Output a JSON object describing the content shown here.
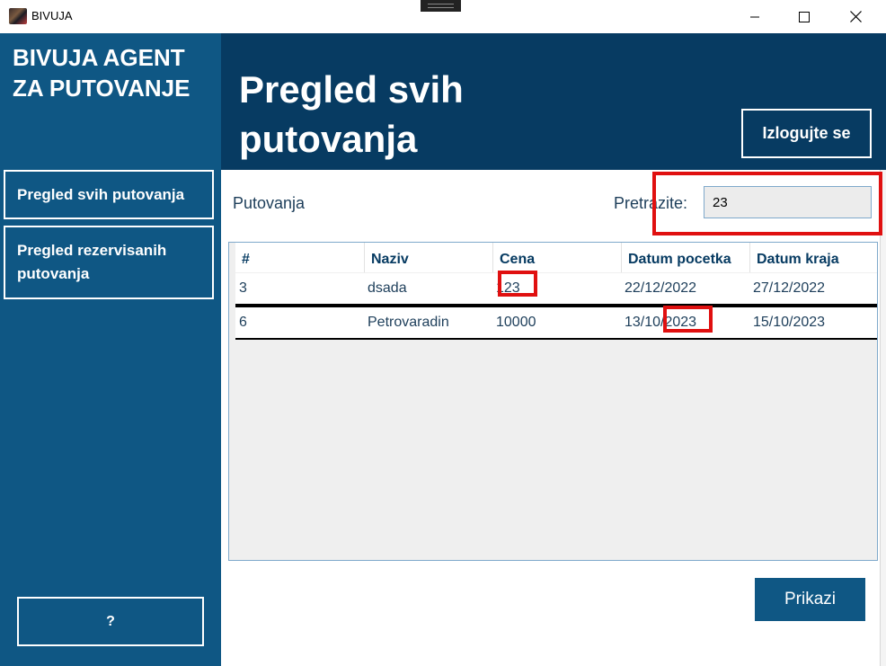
{
  "window": {
    "title": "BIVUJA"
  },
  "sidebar": {
    "brand": "BIVUJA AGENT ZA PUTOVANJE",
    "nav": [
      {
        "label": "Pregled svih putovanja"
      },
      {
        "label": "Pregled rezervisanih putovanja"
      }
    ],
    "help_label": "?"
  },
  "header": {
    "title": "Pregled svih putovanja",
    "logout_label": "Izlogujte se"
  },
  "content": {
    "section_label": "Putovanja",
    "search_label": "Pretrazite:",
    "search_value": "23"
  },
  "table": {
    "columns": [
      "#",
      "Naziv",
      "Cena",
      "Datum pocetka",
      "Datum kraja"
    ],
    "rows": [
      [
        "3",
        "dsada",
        "123",
        "22/12/2022",
        "27/12/2022"
      ],
      [
        "6",
        "Petrovaradin",
        "10000",
        "13/10/2023",
        "15/10/2023"
      ]
    ]
  },
  "footer": {
    "show_label": "Prikazi"
  },
  "colors": {
    "sidebar": "#0f5784",
    "header": "#073b62",
    "highlight": "#e01010"
  }
}
